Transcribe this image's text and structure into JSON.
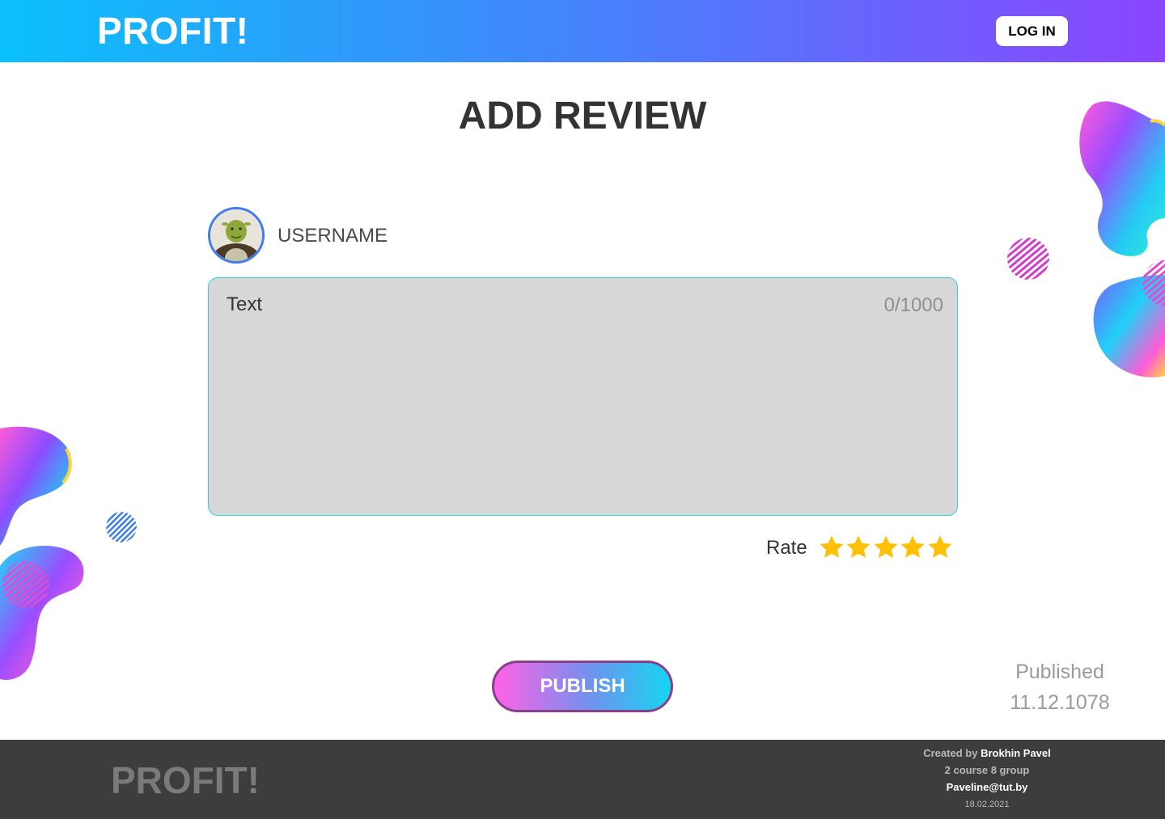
{
  "header": {
    "logo": "PROFIT!",
    "login_label": "LOG IN"
  },
  "page": {
    "title": "ADD REVIEW"
  },
  "user": {
    "username": "USERNAME"
  },
  "review": {
    "placeholder": "Text",
    "counter": "0/1000"
  },
  "rating": {
    "label": "Rate",
    "stars_filled": 5,
    "stars_total": 5,
    "star_color": "#ffc107"
  },
  "publish": {
    "label": "PUBLISH"
  },
  "published": {
    "label": "Published",
    "date": "11.12.1078"
  },
  "footer": {
    "logo": "PROFIT!",
    "created_by_prefix": "Created by",
    "author": "Brokhin Pavel",
    "group": "2 course 8 group",
    "email": "Paveline@tut.by",
    "date": "18.02.2021"
  },
  "colors": {
    "header_gradient_start": "#0ac0fb",
    "header_gradient_end": "#8c45ff",
    "footer_bg": "#3d3d3d",
    "textarea_bg": "#d7d7d7",
    "textarea_border": "#2ed3e0",
    "publish_gradient_start": "#ff61e6",
    "publish_gradient_end": "#14d6f1"
  }
}
